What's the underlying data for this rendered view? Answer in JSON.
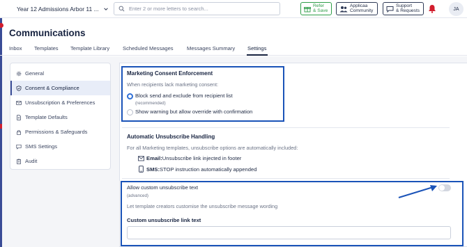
{
  "topbar": {
    "app_selector": "Year 12 Admissions Arbor 11 ...",
    "search_placeholder": "Enter 2 or more letters to search...",
    "refer_line1": "Refer",
    "refer_line2": "& Save",
    "community_line1": "Applicaa",
    "community_line2": "Community",
    "support_line1": "Support",
    "support_line2": "& Requests",
    "avatar_initials": "JA",
    "colors": {
      "refer": "#2e9d48",
      "bell": "#d21d2d"
    }
  },
  "page": {
    "title": "Communications"
  },
  "tabs": [
    {
      "label": "Inbox"
    },
    {
      "label": "Templates"
    },
    {
      "label": "Template Library"
    },
    {
      "label": "Scheduled Messages"
    },
    {
      "label": "Messages Summary"
    },
    {
      "label": "Settings",
      "active": true
    }
  ],
  "side_menu": [
    {
      "label": "General",
      "icon": "gear-icon"
    },
    {
      "label": "Consent & Compliance",
      "icon": "shield-icon",
      "active": true
    },
    {
      "label": "Unsubscription & Preferences",
      "icon": "mail-icon"
    },
    {
      "label": "Template Defaults",
      "icon": "document-icon"
    },
    {
      "label": "Permissions & Safeguards",
      "icon": "lock-icon"
    },
    {
      "label": "SMS Settings",
      "icon": "chat-icon"
    },
    {
      "label": "Audit",
      "icon": "clipboard-icon"
    }
  ],
  "consent": {
    "title": "Marketing Consent Enforcement",
    "prompt": "When recipients lack marketing consent:",
    "options": [
      {
        "label": "Block send and exclude from recipient list",
        "sub": "(recommended)",
        "selected": true
      },
      {
        "label": "Show warning but allow override with confirmation",
        "selected": false
      }
    ]
  },
  "unsubscribe": {
    "title": "Automatic Unsubscribe Handling",
    "description": "For all Marketing templates, unsubscribe options are automatically included:",
    "email_label": "Email:",
    "email_text": "Unsubscribe link injected in footer",
    "sms_label": "SMS:",
    "sms_text": "STOP instruction automatically appended"
  },
  "custom_unsubscribe": {
    "toggle_label": "Allow custom unsubscribe text",
    "toggle_sub": "(advanced)",
    "toggle_on": false,
    "helper": "Let template creators customise the unsubscribe message wording",
    "field_label": "Custom unsubscribe link text",
    "field_value": ""
  },
  "annotation_color": "#1a53b8"
}
